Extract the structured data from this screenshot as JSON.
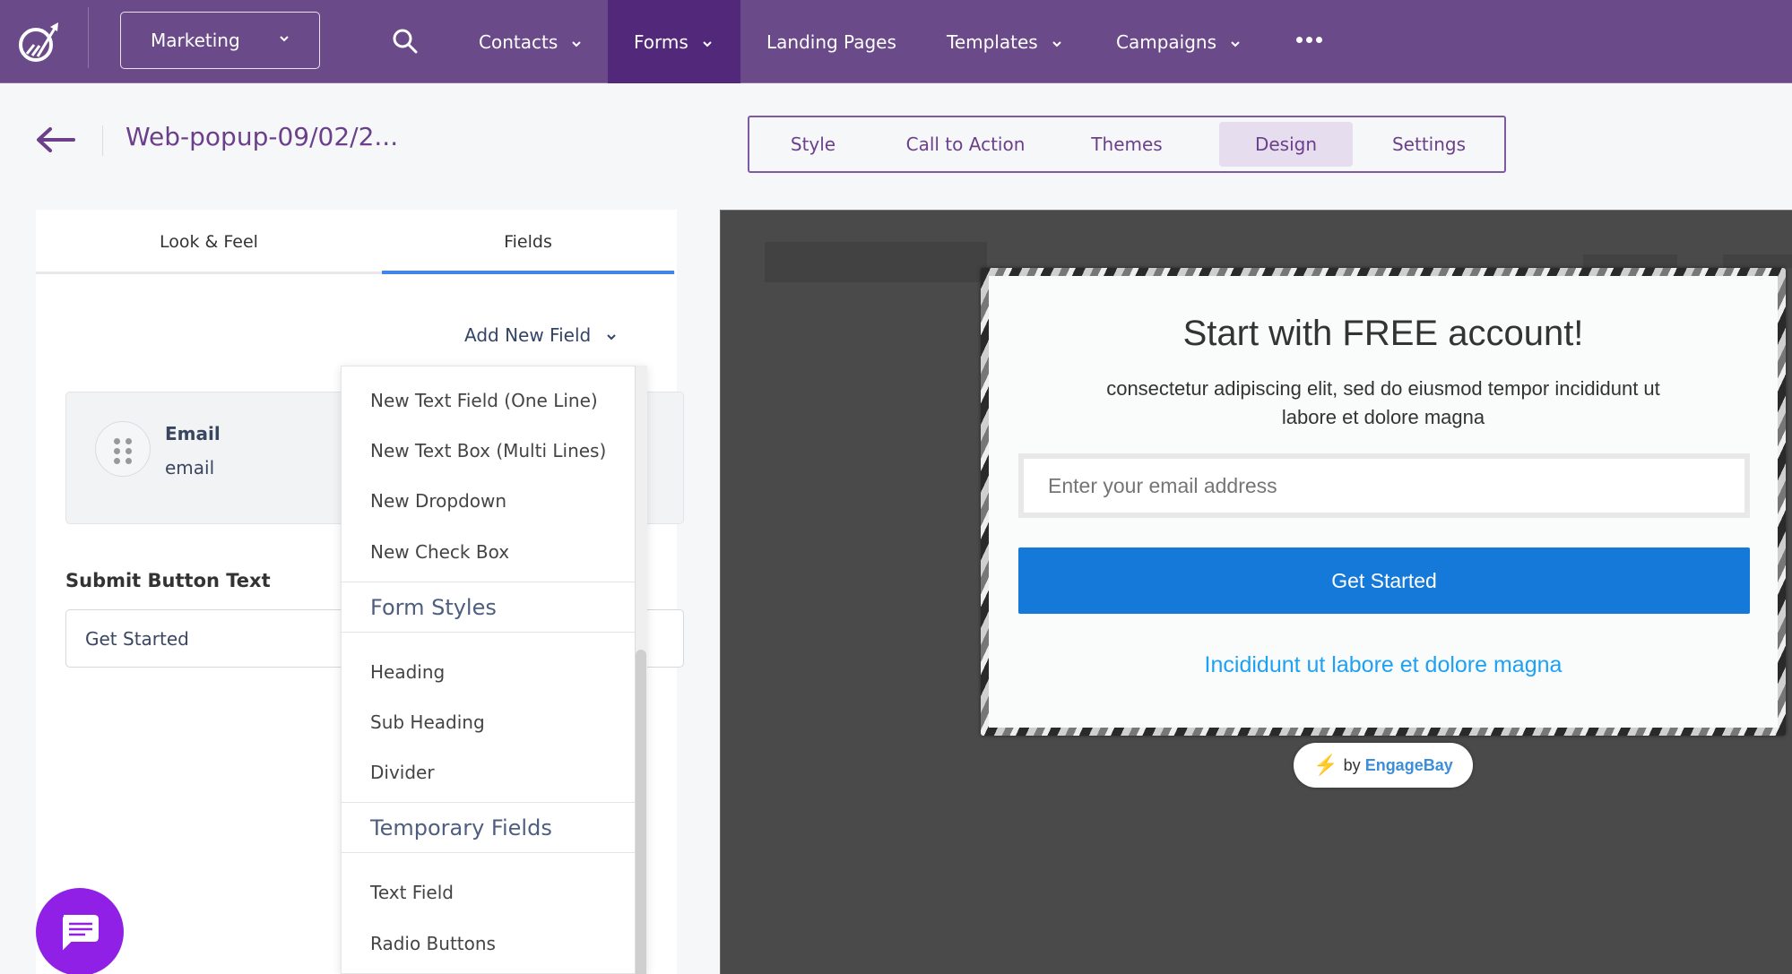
{
  "topnav": {
    "logo_icon": "growth-arrow-logo",
    "app_switch": "Marketing",
    "search_icon": "search-icon",
    "items": [
      {
        "label": "Contacts",
        "has_dropdown": true,
        "active": false
      },
      {
        "label": "Forms",
        "has_dropdown": true,
        "active": true
      },
      {
        "label": "Landing Pages",
        "has_dropdown": false,
        "active": false
      },
      {
        "label": "Templates",
        "has_dropdown": true,
        "active": false
      },
      {
        "label": "Campaigns",
        "has_dropdown": true,
        "active": false
      }
    ],
    "more_icon": "more-horizontal-icon",
    "colors": {
      "bar": "#6B4A8A",
      "active": "#52287A"
    }
  },
  "header": {
    "back_icon": "arrow-left-icon",
    "title": "Web-popup-09/02/2...",
    "tabs": [
      {
        "label": "Style",
        "active": false
      },
      {
        "label": "Call to Action",
        "active": false
      },
      {
        "label": "Themes",
        "active": false
      },
      {
        "label": "Design",
        "active": true
      },
      {
        "label": "Settings",
        "active": false
      }
    ]
  },
  "left_panel": {
    "tabs": [
      {
        "label": "Look & Feel",
        "active": false
      },
      {
        "label": "Fields",
        "active": true
      }
    ],
    "add_field_label": "Add New Field",
    "field_card": {
      "name": "Email",
      "key": "email"
    },
    "submit_label": "Submit Button Text",
    "submit_value": "Get Started",
    "dropdown": {
      "groups": [
        {
          "header": null,
          "items": [
            "New Text Field (One Line)",
            "New Text Box (Multi Lines)",
            "New Dropdown",
            "New Check Box"
          ]
        },
        {
          "header": "Form Styles",
          "items": [
            "Heading",
            "Sub Heading",
            "Divider"
          ]
        },
        {
          "header": "Temporary Fields",
          "items": [
            "Text Field",
            "Radio Buttons"
          ]
        }
      ]
    }
  },
  "chat_widget": {
    "icon": "chat-icon",
    "color": "#9120E6"
  },
  "preview": {
    "title": "Start with FREE account!",
    "subtitle": "consectetur adipiscing elit, sed do eiusmod tempor incididunt ut labore et dolore magna",
    "email_placeholder": "Enter your email address",
    "button_label": "Get Started",
    "button_color": "#1479D9",
    "link_text": "Incididunt ut labore et dolore magna",
    "link_color": "#1DA1F2",
    "branding": {
      "prefix": "by",
      "brand": "EngageBay"
    }
  }
}
